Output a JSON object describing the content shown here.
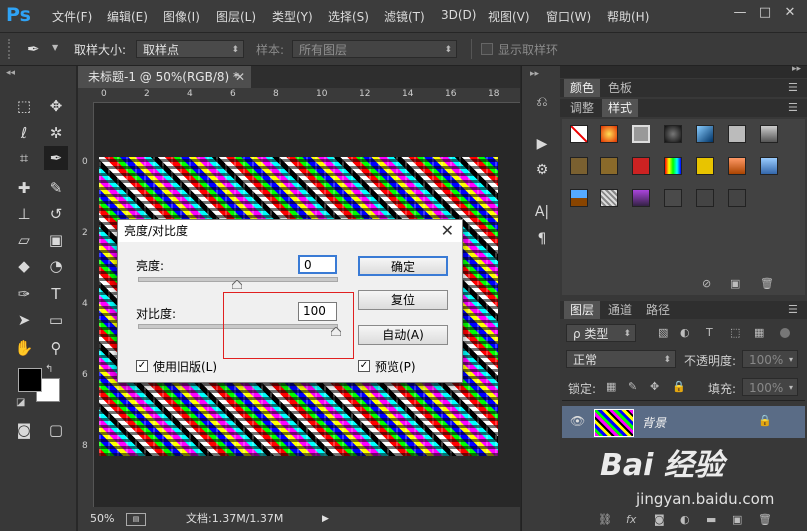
{
  "app": {
    "logo": "Ps",
    "menus": [
      "文件(F)",
      "编辑(E)",
      "图像(I)",
      "图层(L)",
      "类型(Y)",
      "选择(S)",
      "滤镜(T)",
      "3D(D)",
      "视图(V)",
      "窗口(W)",
      "帮助(H)"
    ],
    "window_controls": {
      "minimize": "—",
      "restore": "□",
      "close": "✕"
    }
  },
  "options_bar": {
    "sample_size_label": "取样大小:",
    "sample_size_value": "取样点",
    "sample_label": "样本:",
    "sample_value": "所有图层",
    "show_ring_label": "显示取样环"
  },
  "document": {
    "tab_title": "未标题-1 @ 50%(RGB/8) *",
    "ruler_top": [
      "0",
      "2",
      "4",
      "6",
      "8",
      "10",
      "12",
      "14",
      "16",
      "18"
    ],
    "ruler_left": [
      "0",
      "2",
      "4",
      "6",
      "8",
      "1\n0"
    ],
    "zoom": "50%",
    "doc_info": "文档:1.37M/1.37M"
  },
  "dialog": {
    "title": "亮度/对比度",
    "brightness_label": "亮度:",
    "brightness_value": "0",
    "contrast_label": "对比度:",
    "contrast_value": "100",
    "brightness_level": 0.5,
    "contrast_level": 1.0,
    "ok_label": "确定",
    "reset_label": "复位",
    "auto_label": "自动(A)",
    "legacy_label": "使用旧版(L)",
    "preview_label": "预览(P)",
    "legacy_checked": true,
    "preview_checked": true
  },
  "panels": {
    "top_tabs": [
      "颜色",
      "色板"
    ],
    "style_tabs": [
      "调整",
      "样式"
    ],
    "layer_tabs": [
      "图层",
      "通道",
      "路径"
    ],
    "kind_label": "ρ 类型",
    "blend_mode": "正常",
    "opacity_label": "不透明度:",
    "opacity_value": "100%",
    "lock_label": "锁定:",
    "fill_label": "填充:",
    "fill_value": "100%",
    "layer_name": "背景"
  },
  "colors": {
    "accent": "#2fa3f5",
    "selected_layer": "#5a6c86",
    "highlight_box": "#e02020"
  },
  "watermark": {
    "logo_text": "Bai 经验",
    "url": "jingyan.baidu.com"
  }
}
